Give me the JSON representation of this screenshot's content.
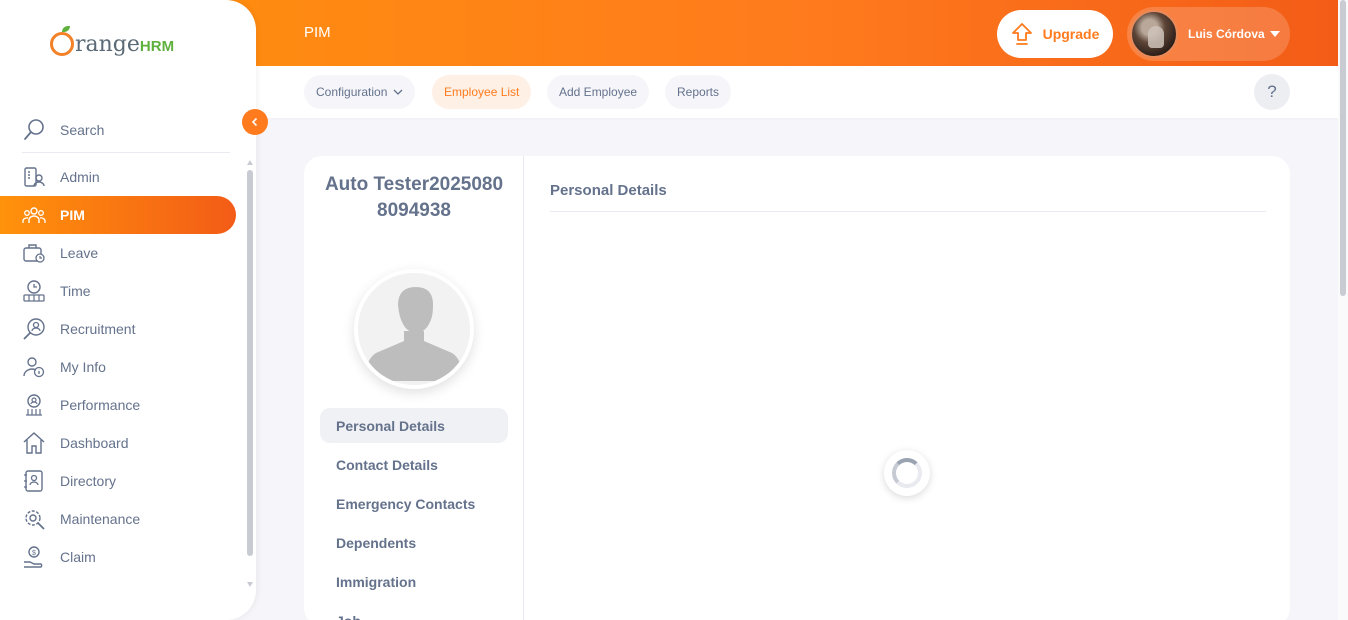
{
  "app": {
    "brand_main": "range",
    "brand_suffix": "HRM"
  },
  "header": {
    "module_title": "PIM",
    "upgrade_label": "Upgrade",
    "user_name": "Luis Córdova"
  },
  "subnav": {
    "items": [
      {
        "label": "Configuration",
        "has_dropdown": true
      },
      {
        "label": "Employee List",
        "active": true
      },
      {
        "label": "Add Employee"
      },
      {
        "label": "Reports"
      }
    ],
    "help_label": "?"
  },
  "sidebar": {
    "search_label": "Search",
    "items": [
      {
        "label": "Admin",
        "icon": "admin-icon"
      },
      {
        "label": "PIM",
        "icon": "pim-icon",
        "active": true
      },
      {
        "label": "Leave",
        "icon": "leave-icon"
      },
      {
        "label": "Time",
        "icon": "time-icon"
      },
      {
        "label": "Recruitment",
        "icon": "recruitment-icon"
      },
      {
        "label": "My Info",
        "icon": "my-info-icon"
      },
      {
        "label": "Performance",
        "icon": "performance-icon"
      },
      {
        "label": "Dashboard",
        "icon": "dashboard-icon"
      },
      {
        "label": "Directory",
        "icon": "directory-icon"
      },
      {
        "label": "Maintenance",
        "icon": "maintenance-icon"
      },
      {
        "label": "Claim",
        "icon": "claim-icon"
      }
    ]
  },
  "employee": {
    "name": "Auto Tester20250808094938"
  },
  "profile_tabs": [
    {
      "label": "Personal Details",
      "active": true
    },
    {
      "label": "Contact Details"
    },
    {
      "label": "Emergency Contacts"
    },
    {
      "label": "Dependents"
    },
    {
      "label": "Immigration"
    },
    {
      "label": "Job"
    }
  ],
  "content": {
    "section_title": "Personal Details",
    "loading": true
  },
  "colors": {
    "accent": "#ff7b1d",
    "brand_green": "#5fb13e",
    "text": "#64728c"
  }
}
